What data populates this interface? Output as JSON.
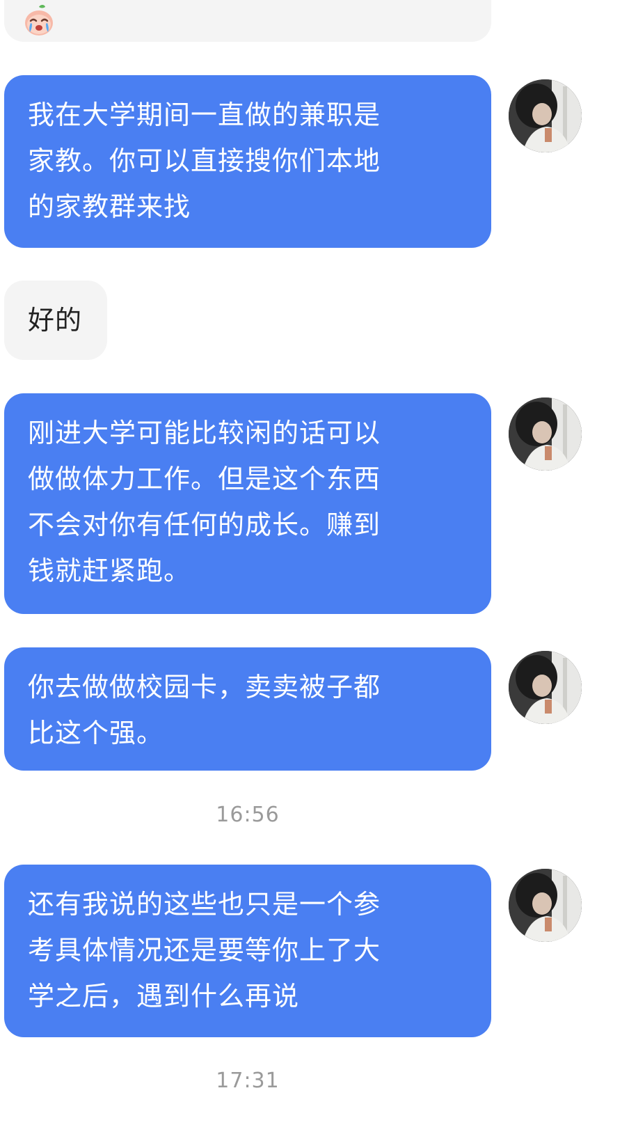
{
  "messages": [
    {
      "lines": [
        "我在大学期间一直做的兼职是",
        "家教。你可以直接搜你们本地",
        "的家教群来找"
      ]
    },
    {
      "text": "好的"
    },
    {
      "lines": [
        "刚进大学可能比较闲的话可以",
        "做做体力工作。但是这个东西",
        "不会对你有任何的成长。赚到",
        "钱就赶紧跑。"
      ]
    },
    {
      "lines": [
        "你去做做校园卡，卖卖被子都",
        "比这个强。"
      ]
    },
    {
      "time": "16:56"
    },
    {
      "lines": [
        "还有我说的这些也只是一个参",
        "考具体情况还是要等你上了大",
        "学之后，遇到什么再说"
      ]
    },
    {
      "time": "17:31"
    }
  ],
  "colors": {
    "sent_bubble": "#4a7ff2",
    "received_bubble": "#f4f4f4",
    "timestamp": "#9a9a9a"
  },
  "icons": {
    "emoji": "crying-peach-emoji-icon",
    "avatar": "user-avatar-photo"
  }
}
